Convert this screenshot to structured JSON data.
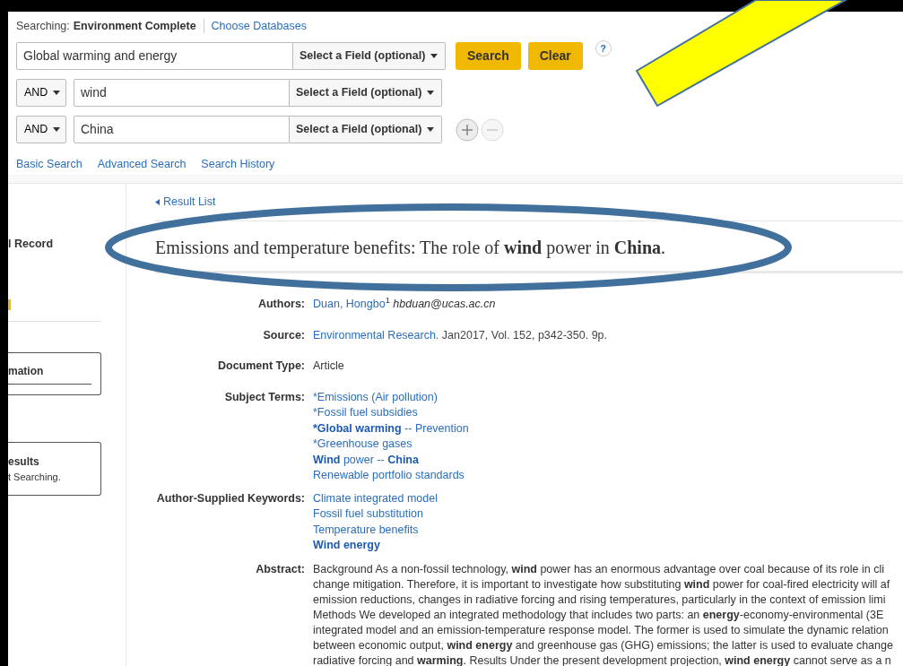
{
  "search": {
    "label": "Searching:",
    "database": "Environment Complete",
    "choose_link": "Choose Databases",
    "rows": [
      {
        "operator": null,
        "value": "Global warming and energy",
        "field": "Select a Field (optional)"
      },
      {
        "operator": "AND",
        "value": "wind",
        "field": "Select a Field (optional)"
      },
      {
        "operator": "AND",
        "value": "China",
        "field": "Select a Field (optional)"
      }
    ],
    "buttons": [
      "Search",
      "Clear"
    ],
    "help": "?",
    "add_row": {
      "disabled": false
    },
    "remove_row": {
      "disabled": true
    },
    "links": [
      "Basic Search",
      "Advanced Search",
      "Search History"
    ]
  },
  "sidebar": {
    "items": [
      {
        "kind": "heading",
        "text": "l Record"
      },
      {
        "kind": "marker"
      },
      {
        "kind": "box",
        "title": "mation"
      },
      {
        "kind": "box",
        "title": "esults",
        "text": "t Searching."
      }
    ]
  },
  "record": {
    "breadcrumb": "Result List",
    "title": "Emissions and temperature benefits: The role of **wind** power in **China**.",
    "fields": [
      {
        "label": "Authors:",
        "kind": "authors",
        "name": "Duan, Hongbo",
        "mark": "1",
        "email": "hbduan@ucas.ac.cn"
      },
      {
        "label": "Source:",
        "kind": "source",
        "link": "Environmental Research.",
        "text": "Jan2017, Vol. 152, p342-350. 9p."
      },
      {
        "label": "Document Type:",
        "kind": "plain",
        "text": "Article"
      },
      {
        "label": "Subject Terms:",
        "kind": "links",
        "items": [
          "*Emissions (Air pollution)",
          "*Fossil fuel subsidies",
          "***Global warming** -- Prevention",
          "*Greenhouse gases",
          "**Wind** power -- **China**",
          "Renewable portfolio standards"
        ]
      },
      {
        "label": "Author-Supplied Keywords:",
        "kind": "links",
        "items": [
          "Climate integrated model",
          "Fossil fuel substitution",
          "Temperature benefits",
          "**Wind energy**"
        ]
      },
      {
        "label": "Abstract:",
        "kind": "lines",
        "items": [
          "Background As a non-fossil technology, **wind** power has an enormous advantage over coal because of its role in cli",
          "change mitigation. Therefore, it is important to investigate how substituting **wind** power for coal-fired electricity will af",
          "emission reductions, changes in radiative forcing and rising temperatures, particularly in the context of emission limi",
          "Methods We developed an integrated methodology that includes two parts: an **energy**-economy-environmental (3E",
          "integrated model and an emission-temperature response model. The former is used to simulate the dynamic relation",
          "between economic output, **wind energy** and greenhouse gas (GHG) emissions; the latter is used to evaluate change",
          "radiative forcing and **warming**. Results Under the present development projection, **wind energy** cannot serve as a n"
        ]
      }
    ]
  }
}
